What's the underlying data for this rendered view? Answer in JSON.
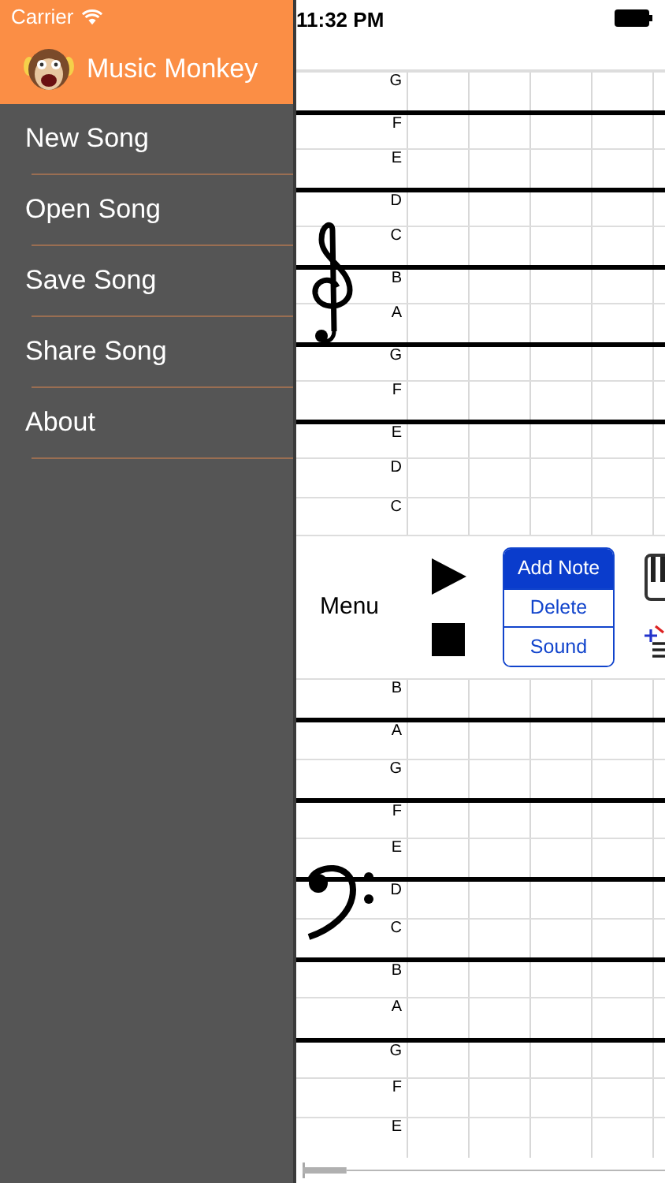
{
  "status_bar": {
    "carrier": "Carrier",
    "time": "11:32 PM"
  },
  "sidebar": {
    "title": "Music Monkey",
    "items": [
      {
        "label": "New Song"
      },
      {
        "label": "Open Song"
      },
      {
        "label": "Save Song"
      },
      {
        "label": "Share Song"
      },
      {
        "label": "About"
      }
    ]
  },
  "staffs": [
    {
      "kind": "treble",
      "rows": [
        {
          "note": "G",
          "line": false
        },
        {
          "note": "F",
          "line": true
        },
        {
          "note": "E",
          "line": false
        },
        {
          "note": "D",
          "line": true
        },
        {
          "note": "C",
          "line": false
        },
        {
          "note": "B",
          "line": true
        },
        {
          "note": "A",
          "line": false
        },
        {
          "note": "G",
          "line": true
        },
        {
          "note": "F",
          "line": false
        },
        {
          "note": "E",
          "line": true
        },
        {
          "note": "D",
          "line": false
        },
        {
          "note": "C",
          "line": false
        }
      ]
    },
    {
      "kind": "bass",
      "rows": [
        {
          "note": "B",
          "line": false
        },
        {
          "note": "A",
          "line": true
        },
        {
          "note": "G",
          "line": false
        },
        {
          "note": "F",
          "line": true
        },
        {
          "note": "E",
          "line": false
        },
        {
          "note": "D",
          "line": true
        },
        {
          "note": "C",
          "line": false
        },
        {
          "note": "B",
          "line": true
        },
        {
          "note": "A",
          "line": false
        },
        {
          "note": "G",
          "line": true
        },
        {
          "note": "F",
          "line": false
        },
        {
          "note": "E",
          "line": false
        }
      ]
    }
  ],
  "panel": {
    "menu_label": "Menu",
    "modes": [
      {
        "label": "Add Note",
        "selected": true
      },
      {
        "label": "Delete",
        "selected": false
      },
      {
        "label": "Sound",
        "selected": false
      }
    ]
  }
}
